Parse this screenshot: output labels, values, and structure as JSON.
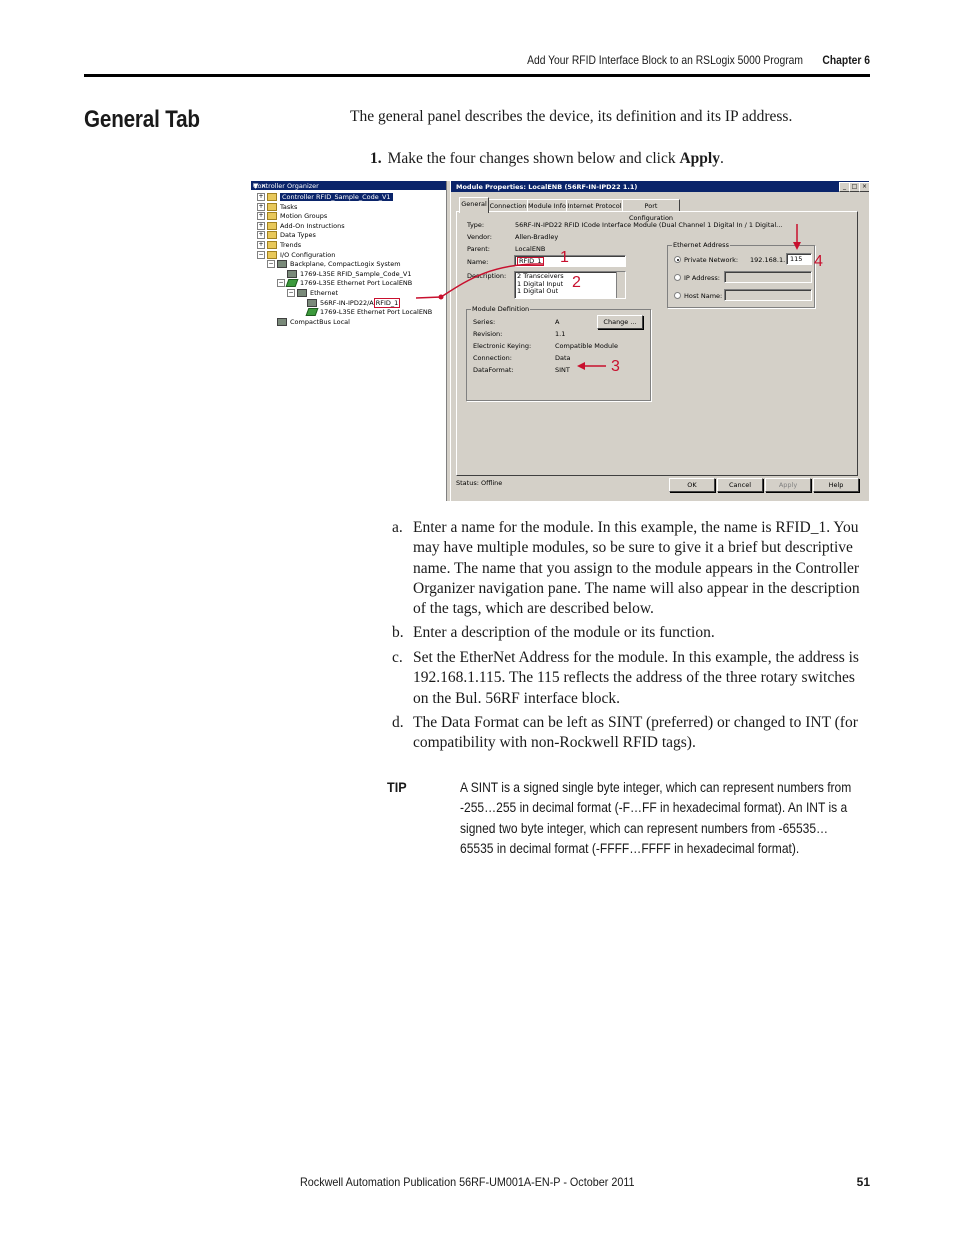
{
  "header": {
    "running_title": "Add Your RFID Interface Block to an RSLogix 5000 Program",
    "chapter": "Chapter 6"
  },
  "section_title": "General Tab",
  "intro": "The general panel describes the device, its definition and its IP address.",
  "step1": {
    "number": "1.",
    "text_before": "Make the four changes shown below and click ",
    "bold": "Apply",
    "text_after": "."
  },
  "screenshot": {
    "organizer": {
      "title": "Controller Organizer",
      "title_buttons": "▼ ×",
      "tree": [
        {
          "label": "Controller RFID_Sample_Code_V1",
          "exp": "+",
          "icon": "folder",
          "indent": 0,
          "selected": true
        },
        {
          "label": "Tasks",
          "exp": "+",
          "icon": "folder",
          "indent": 0
        },
        {
          "label": "Motion Groups",
          "exp": "+",
          "icon": "folder",
          "indent": 0
        },
        {
          "label": "Add-On Instructions",
          "exp": "+",
          "icon": "folder",
          "indent": 0
        },
        {
          "label": "Data Types",
          "exp": "+",
          "icon": "folder",
          "indent": 0
        },
        {
          "label": "Trends",
          "exp": "+",
          "icon": "folder",
          "indent": 0
        },
        {
          "label": "I/O Configuration",
          "exp": "−",
          "icon": "folder",
          "indent": 0
        },
        {
          "label": "Backplane, CompactLogix System",
          "exp": "−",
          "icon": "module",
          "indent": 1
        },
        {
          "label": "1769-L35E RFID_Sample_Code_V1",
          "exp": "",
          "icon": "module",
          "indent": 2
        },
        {
          "label": "1769-L35E Ethernet Port LocalENB",
          "exp": "−",
          "icon": "green",
          "indent": 2
        },
        {
          "label": "Ethernet",
          "exp": "−",
          "icon": "module",
          "indent": 3
        },
        {
          "label": "56RF-IN-IPD22/A",
          "exp": "",
          "icon": "module",
          "indent": 4,
          "tag": "RFID_1"
        },
        {
          "label": "1769-L35E Ethernet Port LocalENB",
          "exp": "",
          "icon": "green",
          "indent": 4
        },
        {
          "label": "CompactBus Local",
          "exp": "",
          "icon": "module",
          "indent": 1
        }
      ]
    },
    "dialog": {
      "title": "Module Properties: LocalENB (56RF-IN-IPD22 1.1)",
      "window_buttons": [
        "_",
        "□",
        "×"
      ],
      "tabs": [
        "General",
        "Connection",
        "Module Info",
        "Internet Protocol",
        "Port Configuration"
      ],
      "type_label": "Type:",
      "type_value": "56RF-IN-IPD22 RFID ICode Interface Module (Dual Channel 1 Digital In / 1 Digital...",
      "vendor_label": "Vendor:",
      "vendor_value": "Allen-Bradley",
      "parent_label": "Parent:",
      "parent_value": "LocalENB",
      "name_label": "Name:",
      "name_value": "RFID_1",
      "description_label": "Description:",
      "description_lines": [
        "2 Transceivers",
        "1 Digital Input",
        "1 Digital Out"
      ],
      "ethernet_group": "Ethernet Address",
      "private_network_label": "Private Network:",
      "private_network_prefix": "192.168.1.",
      "private_network_value": "115",
      "ip_address_label": "IP Address:",
      "host_name_label": "Host Name:",
      "module_def_group": "Module Definition",
      "series_label": "Series:",
      "series_value": "A",
      "revision_label": "Revision:",
      "revision_value": "1.1",
      "keying_label": "Electronic Keying:",
      "keying_value": "Compatible Module",
      "connection_label": "Connection:",
      "connection_value": "Data",
      "dataformat_label": "DataFormat:",
      "dataformat_value": "SINT",
      "change_button": "Change ...",
      "status": "Status:  Offline",
      "buttons": {
        "ok": "OK",
        "cancel": "Cancel",
        "apply": "Apply",
        "help": "Help"
      },
      "callouts": [
        "1",
        "2",
        "3",
        "4"
      ]
    },
    "colors": {
      "callout": "#c8102e",
      "titlebar": "#0a246a",
      "window": "#d4d0c8"
    }
  },
  "list": [
    {
      "letter": "a.",
      "text": "Enter a name for the module. In this example, the name is RFID_1. You may have multiple modules, so be sure to give it a brief but descriptive name. The name that you assign to the module appears in the Controller Organizer navigation pane. The name will also appear in the description of the tags, which are described below."
    },
    {
      "letter": "b.",
      "text": "Enter a description of the module or its function."
    },
    {
      "letter": "c.",
      "text": "Set the EtherNet Address for the module. In this example, the address is 192.168.1.115. The 115 reflects the address of the three rotary switches on the Bul. 56RF interface block."
    },
    {
      "letter": "d.",
      "text": "The Data Format can be left as SINT (preferred) or changed to INT (for compatibility with non-Rockwell RFID tags)."
    }
  ],
  "tip": {
    "label": "TIP",
    "text": "A SINT is a signed single byte integer, which can represent numbers from -255…255 in decimal format (-F…FF in hexadecimal format). An INT is a signed two byte integer, which can represent numbers from -65535…65535 in decimal format (-FFFF…FFFF in hexadecimal format)."
  },
  "footer": {
    "publication": "Rockwell Automation Publication 56RF-UM001A-EN-P - October 2011",
    "page": "51"
  }
}
